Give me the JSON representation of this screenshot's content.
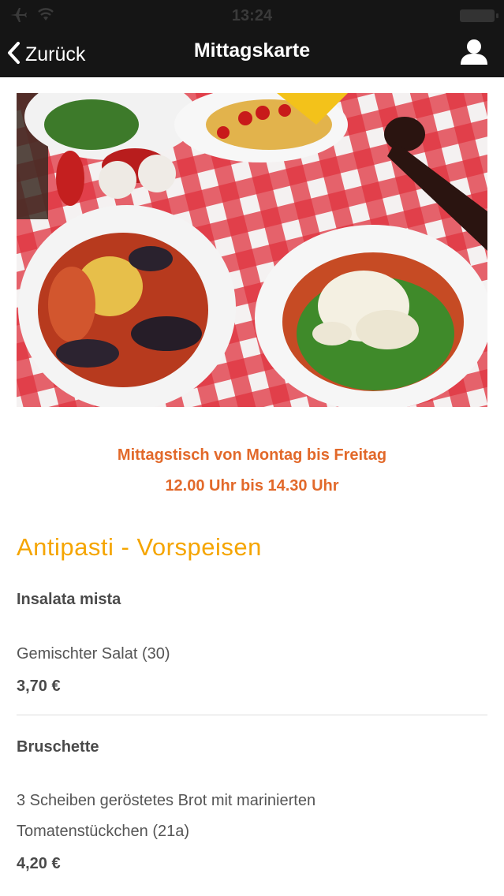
{
  "status_bar": {
    "time": "13:24",
    "icons": [
      "airplane-icon",
      "wifi-icon",
      "battery-icon"
    ]
  },
  "nav": {
    "back_label": "Zurück",
    "title": "Mittagskarte",
    "icons": [
      "chevron-left-icon",
      "user-icon"
    ]
  },
  "hero": {
    "image_description_icon": "food-photo"
  },
  "intro": {
    "line1": "Mittagstisch von Montag bis Freitag",
    "line2": "12.00 Uhr bis 14.30 Uhr"
  },
  "menu": {
    "section_title": "Antipasti - Vorspeisen",
    "items": [
      {
        "name": "Insalata mista",
        "desc_lines": [
          "Gemischter Salat (30)"
        ],
        "price": "3,70 €"
      },
      {
        "name": "Bruschette",
        "desc_lines": [
          "3 Scheiben geröstetes Brot mit marinierten",
          "Tomatenstückchen (21a)"
        ],
        "price": "4,20 €"
      }
    ]
  },
  "colors": {
    "nav_bg": "#151515",
    "intro_text": "#e2692a",
    "section_title": "#f5a500",
    "tablecloth_red": "#e0323f"
  }
}
